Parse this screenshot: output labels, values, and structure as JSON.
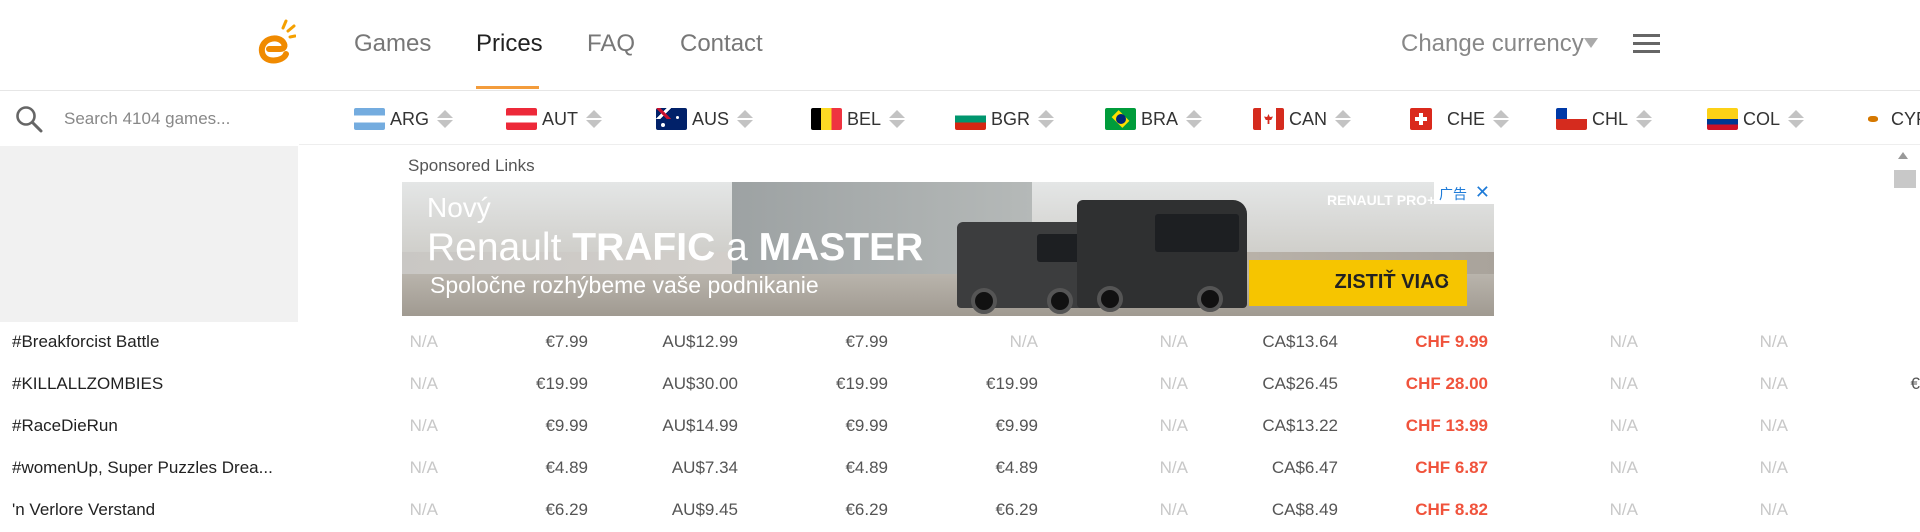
{
  "header": {
    "nav": [
      {
        "label": "Games",
        "active": false
      },
      {
        "label": "Prices",
        "active": true
      },
      {
        "label": "FAQ",
        "active": false
      },
      {
        "label": "Contact",
        "active": false
      }
    ],
    "change_currency": "Change currency",
    "accent_color": "#f39c3c"
  },
  "search": {
    "placeholder": "Search 4104 games..."
  },
  "countries": [
    "ARG",
    "AUT",
    "AUS",
    "BEL",
    "BGR",
    "BRA",
    "CAN",
    "CHE",
    "CHL",
    "COL",
    "CYP"
  ],
  "ad": {
    "sponsored_label": "Sponsored Links",
    "line1": "Nový",
    "line2_a": "Renault ",
    "line2_b": "TRAFIC",
    "line2_c": " a ",
    "line2_d": "MASTER",
    "line3": "Spoločne rozhýbeme vaše podnikanie",
    "cta": "ZISTIŤ VIAC",
    "cta_arrow": "›",
    "brand": "RENAULT PRO+",
    "badge": "广告",
    "close": "✕"
  },
  "games": [
    {
      "name": "#Breakforcist Battle",
      "prices": [
        "N/A",
        "€7.99",
        "AU$12.99",
        "€7.99",
        "N/A",
        "N/A",
        "CA$13.64",
        "CHF 9.99",
        "N/A",
        "N/A",
        ""
      ]
    },
    {
      "name": "#KILLALLZOMBIES",
      "prices": [
        "N/A",
        "€19.99",
        "AU$30.00",
        "€19.99",
        "€19.99",
        "N/A",
        "CA$26.45",
        "CHF 28.00",
        "N/A",
        "N/A",
        "€"
      ]
    },
    {
      "name": "#RaceDieRun",
      "prices": [
        "N/A",
        "€9.99",
        "AU$14.99",
        "€9.99",
        "€9.99",
        "N/A",
        "CA$13.22",
        "CHF 13.99",
        "N/A",
        "N/A",
        ""
      ]
    },
    {
      "name": "#womenUp, Super Puzzles Drea...",
      "prices": [
        "N/A",
        "€4.89",
        "AU$7.34",
        "€4.89",
        "€4.89",
        "N/A",
        "CA$6.47",
        "CHF 6.87",
        "N/A",
        "N/A",
        ""
      ]
    },
    {
      "name": "'n Verlore Verstand",
      "prices": [
        "N/A",
        "€6.29",
        "AU$9.45",
        "€6.29",
        "€6.29",
        "N/A",
        "CA$8.49",
        "CHF 8.82",
        "N/A",
        "N/A",
        ""
      ]
    }
  ],
  "best_price_color": "#f0533c"
}
